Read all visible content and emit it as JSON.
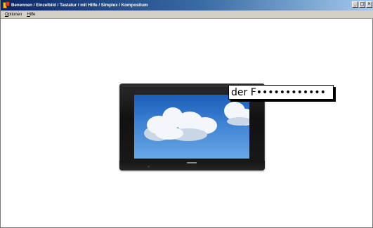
{
  "window": {
    "title": "Benennen / Einzelbild / Tastatur / mit Hilfe / Simplex / Kompositum",
    "controls": [
      "minimize-icon",
      "maximize-icon",
      "close-icon"
    ]
  },
  "menu": {
    "items": [
      {
        "label": "Optionen"
      },
      {
        "label": "Hilfe"
      }
    ]
  },
  "main": {
    "image": "tv-with-clouds",
    "answer": "der F••••••••••••"
  },
  "colors": {
    "titlebar_start": "#0a246a",
    "titlebar_end": "#a6caf0",
    "menubar": "#d4d0c8",
    "background": "#ffffff",
    "sky": "#3d82d4"
  }
}
